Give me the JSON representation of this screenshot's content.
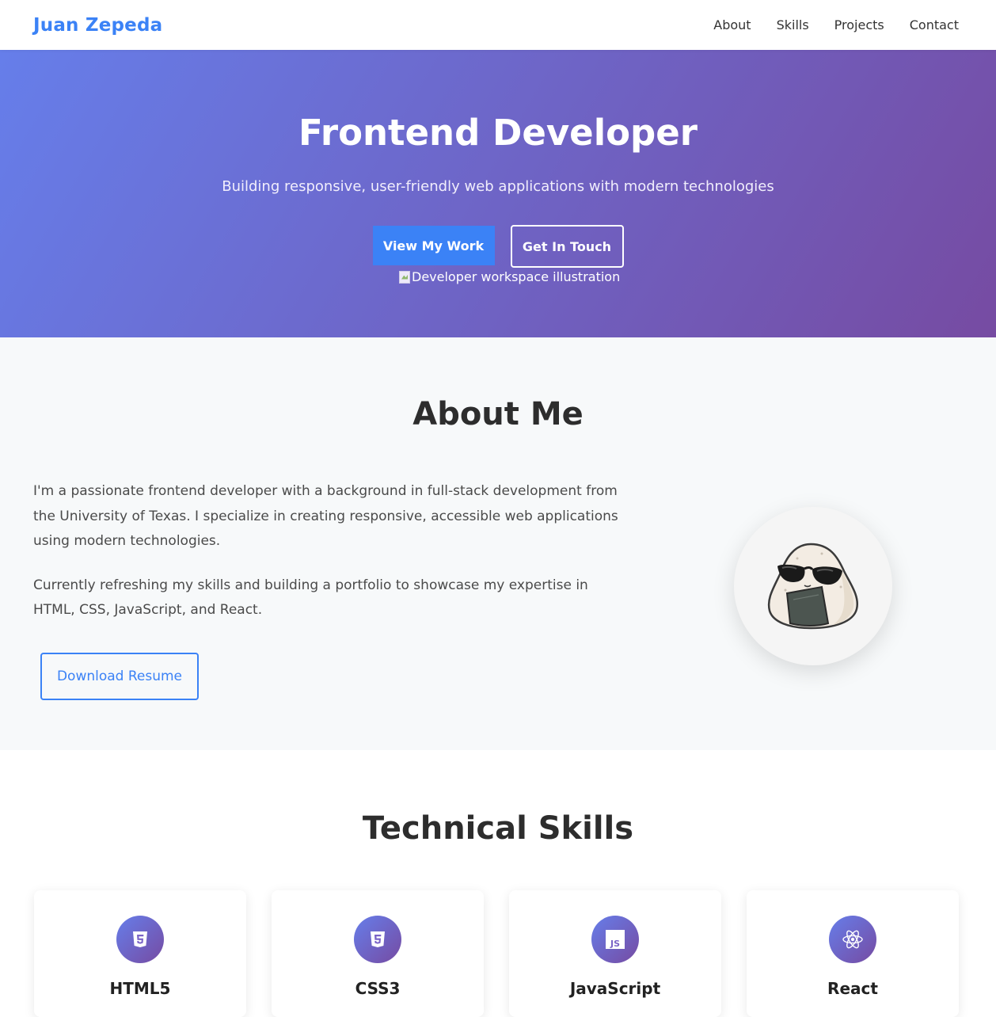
{
  "nav": {
    "brand": "Juan Zepeda",
    "links": [
      "About",
      "Skills",
      "Projects",
      "Contact"
    ]
  },
  "hero": {
    "title": "Frontend Developer",
    "subtitle": "Building responsive, user-friendly web applications with modern technologies",
    "primary_button": "View My Work",
    "secondary_button": "Get In Touch",
    "image_alt": "Developer workspace illustration"
  },
  "about": {
    "title": "About Me",
    "paragraphs": [
      "I'm a passionate frontend developer with a background in full-stack development from the University of Texas. I specialize in creating responsive, accessible web applications using modern technologies.",
      "Currently refreshing my skills and building a portfolio to showcase my expertise in HTML, CSS, JavaScript, and React."
    ],
    "resume_button": "Download Resume",
    "avatar_icon": "onigiri-sunglasses-avatar"
  },
  "skills": {
    "title": "Technical Skills",
    "items": [
      {
        "name": "HTML5",
        "icon": "html5-icon"
      },
      {
        "name": "CSS3",
        "icon": "css3-icon"
      },
      {
        "name": "JavaScript",
        "icon": "javascript-icon"
      },
      {
        "name": "React",
        "icon": "react-icon"
      }
    ]
  },
  "colors": {
    "brand": "#3b82f6",
    "hero_gradient_start": "#667eea",
    "hero_gradient_end": "#764ba2",
    "about_bg": "#f7f9fa"
  }
}
